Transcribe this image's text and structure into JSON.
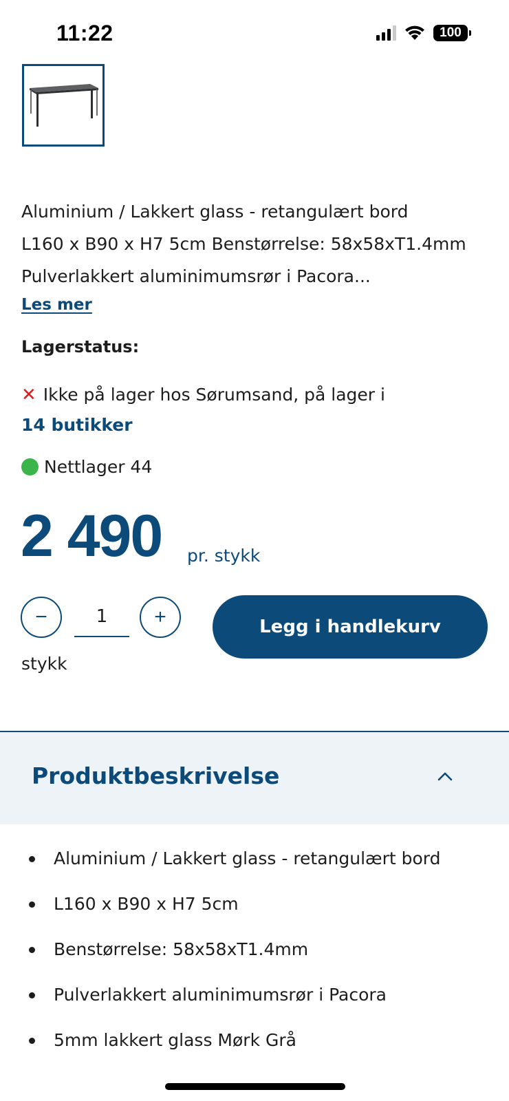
{
  "status_bar": {
    "time": "11:22",
    "battery": "100",
    "icons": [
      "signal-icon",
      "wifi-icon",
      "battery-icon"
    ]
  },
  "product": {
    "thumbnail_alt": "table-thumbnail",
    "intro_line1": "Aluminium / Lakkert glass - retangulært bord",
    "intro_line2": "L160 x B90 x H7 5cm Benstørrelse: 58x58xT1.4mm",
    "intro_line3": "Pulverlakkert aluminimumsrør i Pacora...",
    "read_more": "Les mer"
  },
  "stock": {
    "heading": "Lagerstatus:",
    "store_status": "Ikke på lager hos Sørumsand, på lager i",
    "stores_link": "14 butikker",
    "online_status": "Nettlager 44"
  },
  "price": {
    "amount": "2 490",
    "unit": "pr. stykk"
  },
  "quantity": {
    "value": "1",
    "unit": "stykk",
    "minus_label": "−",
    "plus_label": "+"
  },
  "cart": {
    "add_label": "Legg i handlekurv"
  },
  "description": {
    "title": "Produktbeskrivelse",
    "items": [
      "Aluminium / Lakkert glass - retangulært bord",
      "L160 x B90 x H7 5cm",
      "Benstørrelse: 58x58xT1.4mm",
      "Pulverlakkert aluminimumsrør i Pacora",
      "5mm lakkert glass Mørk Grå"
    ]
  },
  "colors": {
    "brand": "#0b4a79",
    "out_of_stock": "#d62020",
    "in_stock": "#3bb54a",
    "accordion_bg": "#eef3f8"
  }
}
